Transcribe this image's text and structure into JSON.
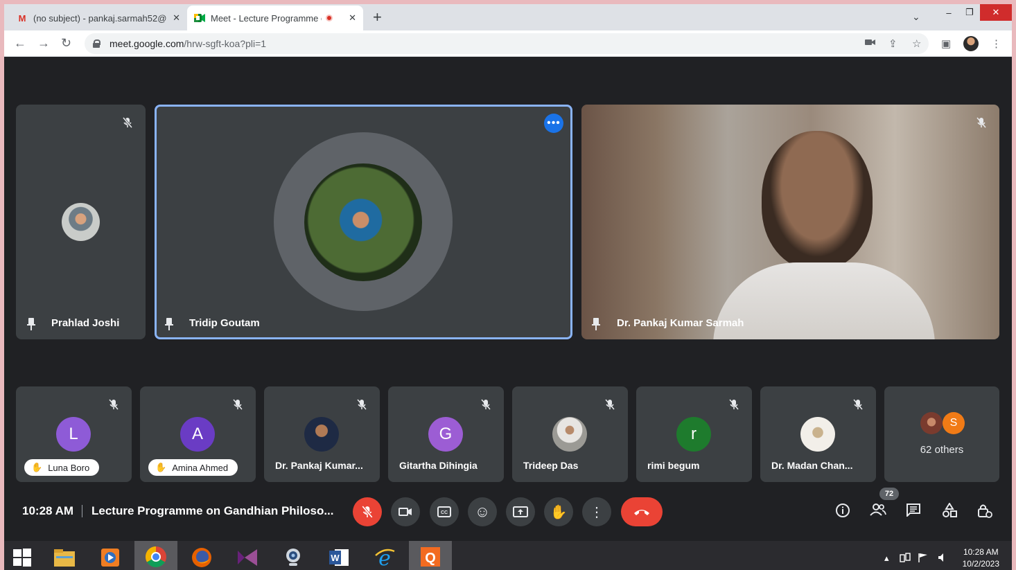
{
  "browser": {
    "tabs": [
      {
        "title": "(no subject) - pankaj.sarmah52@",
        "icon": "gmail-icon"
      },
      {
        "title": "Meet - Lecture Programme c",
        "icon": "meet-icon",
        "recording": true
      }
    ],
    "url_host": "meet.google.com",
    "url_path": "/hrw-sgft-koa?pli=1"
  },
  "meet": {
    "main_tiles": [
      {
        "name": "Prahlad Joshi",
        "muted": true,
        "pinned": true
      },
      {
        "name": "Tridip Goutam",
        "speaking": true,
        "pinned": true
      },
      {
        "name": "Dr. Pankaj Kumar Sarmah",
        "muted": true,
        "pinned": true
      }
    ],
    "strip_tiles": [
      {
        "name": "Luna Boro",
        "letter": "L",
        "color": "#8e5bd7",
        "hand_raised": true
      },
      {
        "name": "Amina Ahmed",
        "letter": "A",
        "color": "#6a3cc4",
        "hand_raised": true
      },
      {
        "name": "Dr. Pankaj Kumar...",
        "photo": true
      },
      {
        "name": "Gitartha Dihingia",
        "letter": "G",
        "color": "#9c5dd4"
      },
      {
        "name": "Trideep Das",
        "photo": true
      },
      {
        "name": "rimi begum",
        "letter": "r",
        "color": "#1e7b2d"
      },
      {
        "name": "Dr. Madan Chan...",
        "photo": true
      }
    ],
    "others": {
      "label": "62 others",
      "letter": "S",
      "color": "#f17b16"
    },
    "time": "10:28 AM",
    "title": "Lecture Programme on Gandhian Philoso...",
    "participant_count": "72"
  },
  "taskbar": {
    "time": "10:28 AM",
    "date": "10/2/2023"
  }
}
